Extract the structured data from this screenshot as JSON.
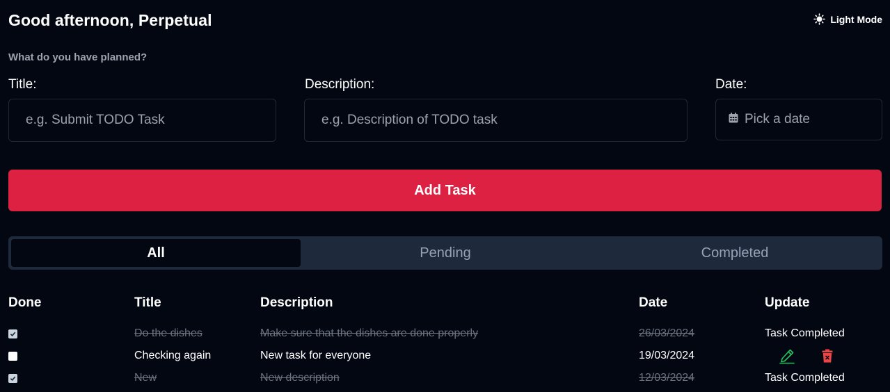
{
  "header": {
    "greeting": "Good afternoon, Perpetual",
    "theme_toggle_label": "Light Mode",
    "theme_icon": "sun-icon"
  },
  "form": {
    "prompt": "What do you have planned?",
    "title_label": "Title:",
    "title_placeholder": "e.g. Submit TODO Task",
    "description_label": "Description:",
    "description_placeholder": "e.g. Description of TODO task",
    "date_label": "Date:",
    "date_placeholder": "Pick a date",
    "date_icon": "calendar-icon",
    "add_button_label": "Add Task"
  },
  "tabs": [
    {
      "label": "All",
      "active": true
    },
    {
      "label": "Pending",
      "active": false
    },
    {
      "label": "Completed",
      "active": false
    }
  ],
  "table": {
    "headers": [
      "Done",
      "Title",
      "Description",
      "Date",
      "Update"
    ],
    "rows": [
      {
        "done": true,
        "title": "Do the dishes",
        "description": "Make sure that the dishes are done properly",
        "date": "26/03/2024",
        "update": "Task Completed"
      },
      {
        "done": false,
        "title": "Checking again",
        "description": "New task for everyone",
        "date": "19/03/2024",
        "update": ""
      },
      {
        "done": true,
        "title": "New",
        "description": "New description",
        "date": "12/03/2024",
        "update": "Task Completed"
      }
    ]
  },
  "colors": {
    "background": "#030712",
    "accent": "#dc2143",
    "edit_icon": "#22c55e",
    "delete_icon": "#ef4444"
  }
}
